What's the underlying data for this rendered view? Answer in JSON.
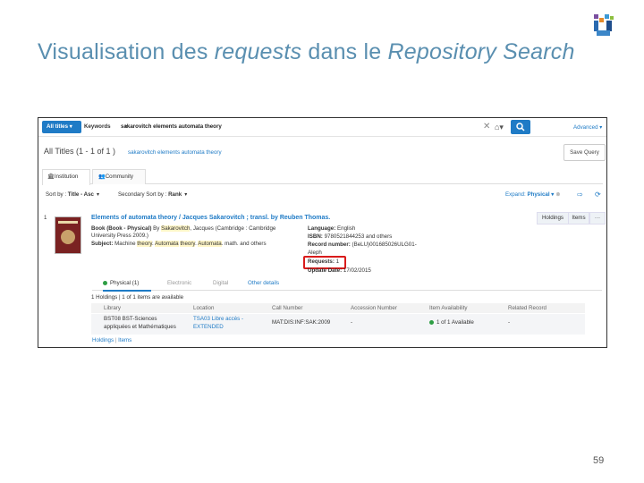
{
  "slide": {
    "title_prefix": "Visualisation des ",
    "title_em1": "requests",
    "title_mid": " dans le ",
    "title_em2": "Repository Search",
    "page_number": "59"
  },
  "search": {
    "scope": "All titles ▾",
    "field": "Keywords",
    "field_caret": "▾",
    "query": "sakarovitch elements automata theory",
    "advanced": "Advanced ▾"
  },
  "results": {
    "title": "All Titles (1 - 1 of 1 )",
    "query_link": "sakarovitch elements automata theory",
    "save_query": "Save Query"
  },
  "tabs": {
    "institution": "Institution",
    "community": "Community"
  },
  "sort": {
    "sort_by": "Sort by : ",
    "sort_value": "Title - Asc",
    "secondary": "Secondary Sort by : ",
    "secondary_value": "Rank",
    "expand": "Expand: ",
    "expand_value": "Physical ▾"
  },
  "record": {
    "index": "1",
    "title_a": "Elements of automata theory / Jacques Sakarovitch ; transl. by Reuben Thomas.",
    "line1_label": "Book (Book - Physical)",
    "line1_by": " By ",
    "line1_author": "Sakarovitch",
    "line1_rest": ", Jacques (Cambridge : Cambridge",
    "line2": "University Press 2009.)",
    "subject_label": "Subject:",
    "subject_1": " Machine ",
    "subject_theory": "theory",
    "subject_dot": ". ",
    "subject_automata": "Automata",
    "subject_sp": " ",
    "subject_theory2": "theory",
    "subject_dot2": ". ",
    "subject_automata2": "Automata",
    "subject_rest": ". math. and others",
    "language_label": "Language:",
    "language": " English",
    "isbn_label": "ISBN:",
    "isbn": " 9780521844253 and others",
    "recnum_label": "Record number:",
    "recnum": " (BeLU)001685026ULG01-",
    "recnum2": "Aleph",
    "requests_label": "Requests:",
    "requests": " 1",
    "update_label": "Update Date:",
    "update": " 17/02/2015",
    "holdings_btn": "Holdings",
    "items_btn": "Items",
    "more_btn": "···"
  },
  "inventory_tabs": {
    "physical": "Physical (1)",
    "electronic": "Electronic",
    "digital": "Digital",
    "other": "Other details"
  },
  "holdings": {
    "summary": "1 Holdings | 1 of 1 items are available",
    "headers": [
      "Library",
      "Location",
      "Call Number",
      "Accession Number",
      "Item Availability",
      "Related Record"
    ],
    "row": {
      "library1": "BST08 BST-Sciences",
      "library2": "appliquées et Mathématiques",
      "location1": "TSA03 Libre accès -",
      "location2": "EXTENDED",
      "call_number": "MAT:DIS:INF:SAK:2009",
      "accession": "-",
      "availability": "1 of 1 Available",
      "related": "-"
    },
    "footer_holdings": "Holdings",
    "footer_sep": " | ",
    "footer_items": "Items"
  },
  "colors": {
    "title_blue": "#5a8fb0",
    "alma_blue": "#1f7bc6",
    "request_box_red": "#d91b1b",
    "available_green": "#2e9e44"
  }
}
